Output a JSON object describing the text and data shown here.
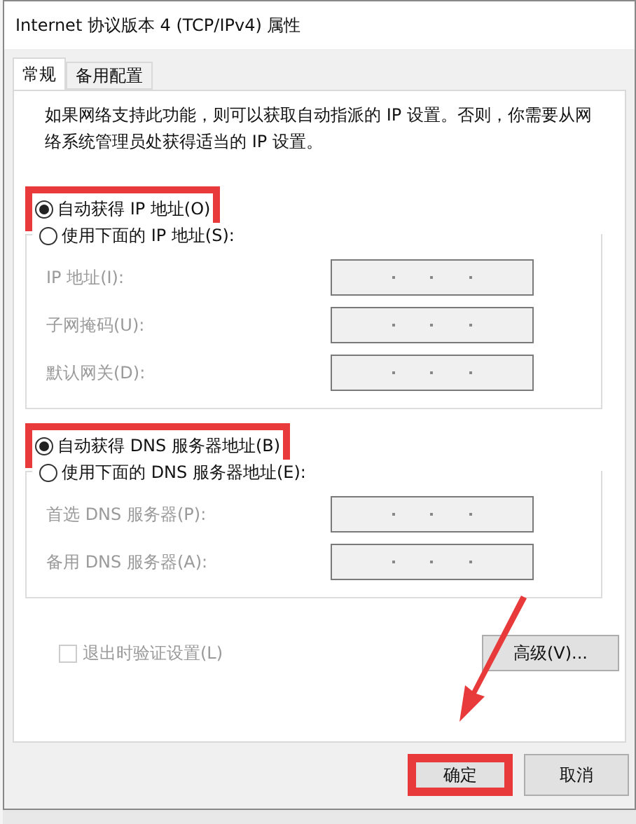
{
  "window": {
    "title": "Internet 协议版本 4 (TCP/IPv4) 属性"
  },
  "tabs": [
    {
      "label": "常规",
      "selected": true
    },
    {
      "label": "备用配置",
      "selected": false
    }
  ],
  "description": "如果网络支持此功能，则可以获取自动指派的 IP 设置。否则，你需要从网络系统管理员处获得适当的 IP 设置。",
  "ip_section": {
    "options": [
      {
        "label": "自动获得 IP 地址(O)",
        "selected": true,
        "highlighted": true
      },
      {
        "label": "使用下面的 IP 地址(S):",
        "selected": false,
        "highlighted": false
      }
    ],
    "fields": [
      {
        "label": "IP 地址(I):",
        "disabled": true
      },
      {
        "label": "子网掩码(U):",
        "disabled": true
      },
      {
        "label": "默认网关(D):",
        "disabled": true
      }
    ]
  },
  "dns_section": {
    "options": [
      {
        "label": "自动获得 DNS 服务器地址(B)",
        "selected": true,
        "highlighted": true
      },
      {
        "label": "使用下面的 DNS 服务器地址(E):",
        "selected": false,
        "highlighted": false
      }
    ],
    "fields": [
      {
        "label": "首选 DNS 服务器(P):",
        "disabled": true
      },
      {
        "label": "备用 DNS 服务器(A):",
        "disabled": true
      }
    ]
  },
  "validate_checkbox": {
    "label": "退出时验证设置(L)",
    "checked": false,
    "disabled": true
  },
  "advanced_button": "高级(V)...",
  "buttons": [
    {
      "label": "确定",
      "highlighted": true
    },
    {
      "label": "取消",
      "highlighted": false
    }
  ]
}
